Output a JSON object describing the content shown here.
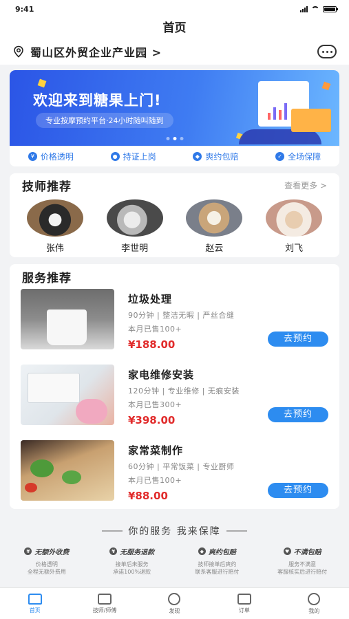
{
  "status_bar": {
    "time": "9:41"
  },
  "header": {
    "title": "首页"
  },
  "location": {
    "text": "蜀山区外贸企业产业园 >"
  },
  "banner": {
    "title": "欢迎来到糖果上门!",
    "subtitle": "专业按摩预约平台·24小时随叫随到",
    "slides": 3,
    "active_slide": 1
  },
  "features": [
    {
      "label": "价格透明",
      "icon": "yen-icon"
    },
    {
      "label": "持证上岗",
      "icon": "person-icon"
    },
    {
      "label": "爽约包赔",
      "icon": "compensation-icon"
    },
    {
      "label": "全场保障",
      "icon": "check-icon"
    }
  ],
  "technicians": {
    "title": "技师推荐",
    "more": "查看更多 >",
    "items": [
      {
        "name": "张伟"
      },
      {
        "name": "李世明"
      },
      {
        "name": "赵云"
      },
      {
        "name": "刘飞"
      }
    ]
  },
  "services": {
    "title": "服务推荐",
    "book_label": "去预约",
    "items": [
      {
        "name": "垃圾处理",
        "tags": "90分钟 | 整洁无暇 | 严丝合缝",
        "sold": "本月已售100+",
        "price": "¥188.00"
      },
      {
        "name": "家电维修安装",
        "tags": "120分钟 | 专业维修 | 无痕安装",
        "sold": "本月已售300+",
        "price": "¥398.00"
      },
      {
        "name": "家常菜制作",
        "tags": "60分钟 | 平常饭菜 | 专业厨师",
        "sold": "本月已售100+",
        "price": "¥88.00"
      }
    ]
  },
  "guarantee": {
    "title": "你的服务 我来保障",
    "items": [
      {
        "title": "无额外收费",
        "line1": "价格透明",
        "line2": "全程无额外费用"
      },
      {
        "title": "无服务退款",
        "line1": "接单后未服务",
        "line2": "承诺100%退款"
      },
      {
        "title": "爽约包赔",
        "line1": "技师接单后爽约",
        "line2": "联系客服进行赔付"
      },
      {
        "title": "不满包赔",
        "line1": "服务不满意",
        "line2": "客服核实后进行赔付"
      }
    ]
  },
  "tab_bar": [
    {
      "label": "首页",
      "icon": "home-icon",
      "active": true
    },
    {
      "label": "技师/师傅",
      "icon": "technician-icon",
      "active": false
    },
    {
      "label": "发现",
      "icon": "discover-icon",
      "active": false
    },
    {
      "label": "订单",
      "icon": "order-icon",
      "active": false
    },
    {
      "label": "我的",
      "icon": "profile-icon",
      "active": false
    }
  ],
  "colors": {
    "accent": "#2d8cf0",
    "price": "#e12b2b",
    "banner": "#2b55e6"
  }
}
